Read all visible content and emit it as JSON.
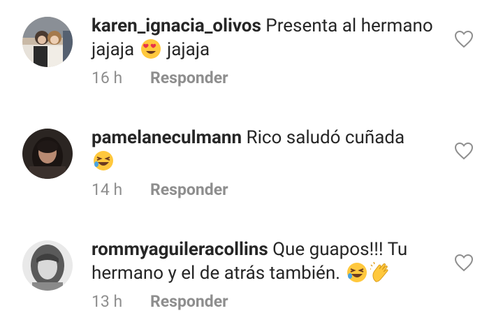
{
  "comments": [
    {
      "username": "karen_ignacia_olivos",
      "text_part1": " Presenta  al hermano jajaja ",
      "emoji1": "heart-eyes-emoji",
      "text_part2": " jajaja",
      "time": "16 h",
      "reply_label": "Responder",
      "avatar": "avatar-karen"
    },
    {
      "username": "pamelaneculmann",
      "text_part1": " Rico saludó cuñada",
      "emoji1": "laughing-emoji",
      "text_part2": "",
      "time": "14 h",
      "reply_label": "Responder",
      "avatar": "avatar-pamela"
    },
    {
      "username": "rommyaguileracollins",
      "text_part1": " Que guapos!!! Tu hermano y el de atrás también. ",
      "emoji1": "laughing-emoji",
      "emoji2": "clapping-hands-emoji",
      "text_part2": "",
      "time": "13 h",
      "reply_label": "Responder",
      "avatar": "avatar-rommy"
    }
  ],
  "colors": {
    "text": "#262626",
    "secondary": "#8e8e8e",
    "heart_outline": "#8e8e8e",
    "emoji_yellow": "#FFC83D"
  },
  "icons": {
    "like": "heart-outline-icon"
  }
}
